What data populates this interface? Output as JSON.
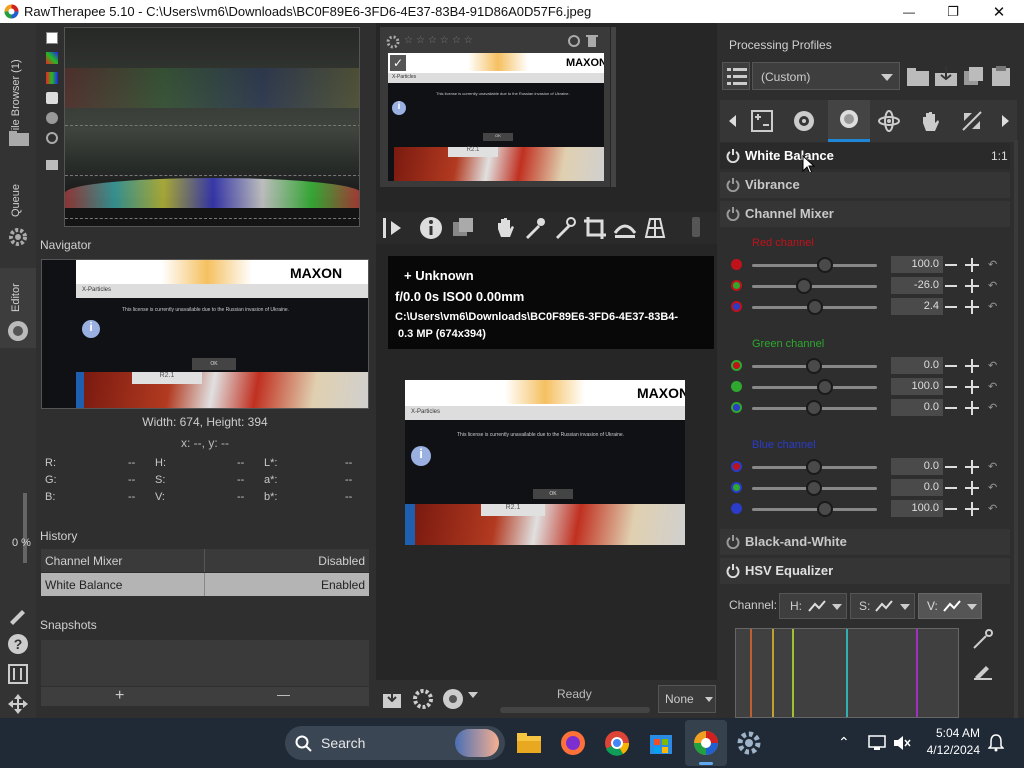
{
  "window": {
    "title": "RawTherapee 5.10 - C:\\Users\\vm6\\Downloads\\BC0F89E6-3FD6-4E37-83B4-91D86A0D57F6.jpeg",
    "minimize": "—",
    "maximize": "❐",
    "close": "✕"
  },
  "vtabs": {
    "file_browser": "File Browser (1)",
    "queue": "Queue",
    "editor": "Editor",
    "zoom_pct": "0 %"
  },
  "navigator": {
    "title": "Navigator",
    "size_text": "Width: 674, Height: 394",
    "coords": "x: --, y: --",
    "rows": [
      {
        "a_label": "R:",
        "a_val": "--",
        "b_label": "H:",
        "b_val": "--",
        "c_label": "L*:",
        "c_val": "--"
      },
      {
        "a_label": "G:",
        "a_val": "--",
        "b_label": "S:",
        "b_val": "--",
        "c_label": "a*:",
        "c_val": "--"
      },
      {
        "a_label": "B:",
        "a_val": "--",
        "b_label": "V:",
        "b_val": "--",
        "c_label": "b*:",
        "c_val": "--"
      }
    ]
  },
  "history": {
    "title": "History",
    "items": [
      {
        "name": "Channel Mixer",
        "status": "Disabled"
      },
      {
        "name": "White Balance",
        "status": "Enabled"
      }
    ]
  },
  "snapshots": {
    "title": "Snapshots",
    "add": "+",
    "remove": "—"
  },
  "thumbnail_image": {
    "brand": "MAXON",
    "product": "X-Particles",
    "message": "This license is currently unavailable due to the Russian invasion of Ukraine.",
    "ok": "OK",
    "version": "R2.1"
  },
  "info_overlay": {
    "camera": "+ Unknown",
    "exposure": "f/0.0  0s  ISO0  0.00mm",
    "path": "C:\\Users\\vm6\\Downloads\\BC0F89E6-3FD6-4E37-83B4-",
    "mp": "0.3 MP (674x394)"
  },
  "status": {
    "ready": "Ready",
    "none_option": "None"
  },
  "profiles": {
    "title": "Processing Profiles",
    "selected": "(Custom)"
  },
  "tools": {
    "white_balance": "White Balance",
    "zoom": "1:1",
    "vibrance": "Vibrance",
    "channel_mixer": "Channel Mixer",
    "red_channel": "Red channel",
    "green_channel": "Green channel",
    "blue_channel": "Blue channel",
    "red_values": [
      "100.0",
      "-26.0",
      "2.4"
    ],
    "green_values": [
      "0.0",
      "100.0",
      "0.0"
    ],
    "blue_values": [
      "0.0",
      "0.0",
      "100.0"
    ],
    "black_and_white": "Black-and-White",
    "hsv_equalizer": "HSV Equalizer",
    "hsv_channel": "Channel:",
    "hsv_h": "H:",
    "hsv_s": "S:",
    "hsv_v": "V:"
  },
  "taskbar": {
    "search": "Search",
    "time": "5:04 AM",
    "date": "4/12/2024"
  },
  "colors": {
    "red": "#c0121b",
    "green": "#2fa82f",
    "blue": "#2a3cc8",
    "accent": "#1f87d6"
  }
}
